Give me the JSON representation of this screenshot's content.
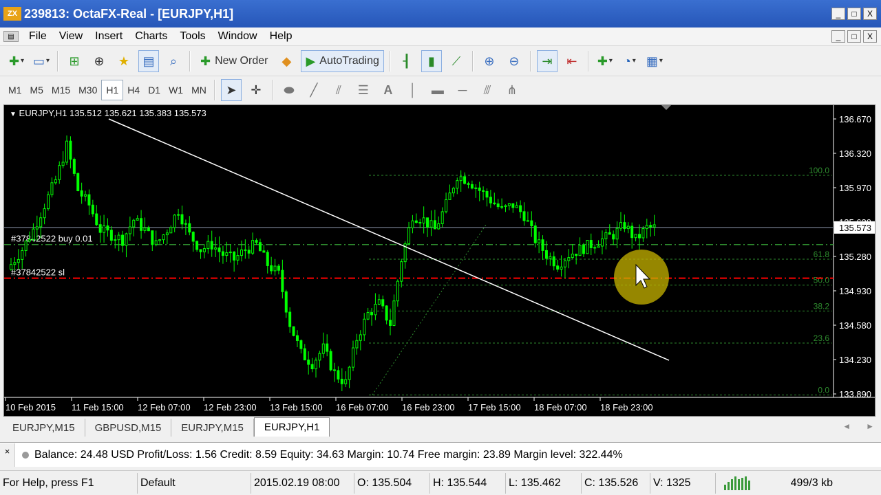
{
  "window": {
    "title": "239813: OctaFX-Real - [EURJPY,H1]",
    "logo_text": "ZX",
    "minimize": "_",
    "maximize": "□",
    "close": "X"
  },
  "menu": [
    "File",
    "View",
    "Insert",
    "Charts",
    "Tools",
    "Window",
    "Help"
  ],
  "toolbar": {
    "new_order": "New Order",
    "autotrading": "AutoTrading"
  },
  "timeframes": [
    "M1",
    "M5",
    "M15",
    "M30",
    "H1",
    "H4",
    "D1",
    "W1",
    "MN"
  ],
  "active_timeframe": "H1",
  "chart": {
    "header": "EURJPY,H1  135.512 135.621 135.383 135.573",
    "bid_label": "135.573",
    "order_label": "#37842522 buy 0.01",
    "sl_label": "#37842522 sl",
    "price_ticks": [
      "136.670",
      "136.320",
      "135.970",
      "135.630",
      "135.280",
      "134.930",
      "134.580",
      "134.230",
      "133.890"
    ],
    "time_ticks": [
      "10 Feb 2015",
      "11 Feb 15:00",
      "12 Feb 07:00",
      "12 Feb 23:00",
      "13 Feb 15:00",
      "16 Feb 07:00",
      "16 Feb 23:00",
      "17 Feb 15:00",
      "18 Feb 07:00",
      "18 Feb 23:00"
    ],
    "fib_levels": [
      "100.0",
      "61.8",
      "50.0",
      "38.2",
      "23.6",
      "0.0"
    ],
    "colors": {
      "background": "#000000",
      "candles": "#00ff00",
      "trendline": "#ffffff",
      "sl_line": "#ff0000",
      "fib": "#2e8b2e",
      "cursor_halo": "#c8b400"
    }
  },
  "chart_data": {
    "type": "candlestick",
    "symbol": "EURJPY",
    "timeframe": "H1",
    "ylim": [
      133.89,
      136.67
    ],
    "approx_close": [
      135.2,
      135.35,
      135.55,
      135.8,
      136.05,
      136.4,
      135.95,
      135.8,
      135.55,
      135.5,
      135.45,
      135.65,
      135.55,
      135.4,
      135.55,
      135.75,
      135.5,
      135.35,
      135.4,
      135.3,
      135.25,
      135.35,
      135.4,
      135.2,
      135.1,
      134.6,
      134.3,
      134.2,
      134.35,
      134.1,
      134.0,
      134.45,
      134.7,
      134.8,
      134.6,
      135.25,
      135.7,
      135.65,
      135.55,
      135.8,
      136.1,
      136.05,
      135.95,
      135.85,
      135.75,
      135.8,
      135.7,
      135.45,
      135.3,
      135.2,
      135.3,
      135.35,
      135.4,
      135.45,
      135.5,
      135.6,
      135.45,
      135.57
    ],
    "order": {
      "ticket": "#37842522",
      "type": "buy",
      "volume": 0.01,
      "open": 135.4,
      "sl": 135.06
    },
    "bid": 135.573
  },
  "tabs": [
    "EURJPY,M15",
    "GBPUSD,M15",
    "EURJPY,M15",
    "EURJPY,H1"
  ],
  "active_tab": "EURJPY,H1",
  "tab_arrows": {
    "left": "◄",
    "right": "►"
  },
  "terminal": {
    "close": "×",
    "account": "Balance: 24.48 USD  Profit/Loss: 1.56  Credit: 8.59  Equity: 34.63  Margin: 10.74  Free margin: 23.89  Margin level: 322.44%"
  },
  "status": {
    "help": "For Help, press F1",
    "profile": "Default",
    "datetime": "2015.02.19 08:00",
    "open": "O: 135.504",
    "high": "H: 135.544",
    "low": "L: 135.462",
    "close": "C: 135.526",
    "volume": "V: 1325",
    "traffic": "499/3 kb"
  }
}
